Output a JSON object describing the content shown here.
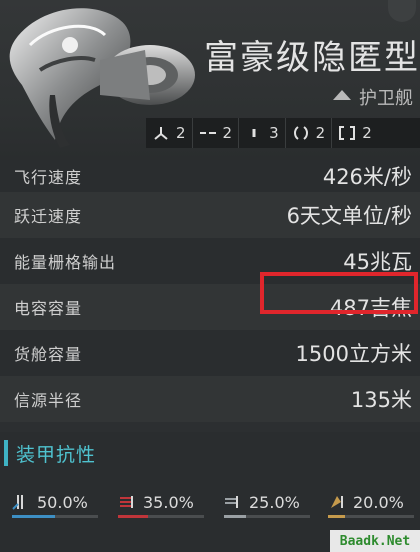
{
  "ship": {
    "name": "富豪级隐匿型",
    "class": "护卫舰"
  },
  "slots": [
    {
      "icon": "high-slot-icon",
      "count": "2"
    },
    {
      "icon": "mid-slot-icon",
      "count": "2"
    },
    {
      "icon": "low-slot-icon",
      "count": "3"
    },
    {
      "icon": "rig-slot-icon",
      "count": "2"
    },
    {
      "icon": "subsystem-slot-icon",
      "count": "2"
    }
  ],
  "stats": [
    {
      "label": "飞行速度",
      "value": "426米/秒"
    },
    {
      "label": "跃迁速度",
      "value": "6天文单位/秒"
    },
    {
      "label": "能量栅格输出",
      "value": "45兆瓦"
    },
    {
      "label": "电容容量",
      "value": "487吉焦"
    },
    {
      "label": "货舱容量",
      "value": "1500立方米"
    },
    {
      "label": "信源半径",
      "value": "135米"
    }
  ],
  "armor": {
    "title": "装甲抗性",
    "resists": [
      {
        "icon": "em-resist-icon",
        "value": "50.0%",
        "fraction": 0.5,
        "color": "#3d8fc4"
      },
      {
        "icon": "thermal-resist-icon",
        "value": "35.0%",
        "fraction": 0.35,
        "color": "#c0353a"
      },
      {
        "icon": "kinetic-resist-icon",
        "value": "25.0%",
        "fraction": 0.25,
        "color": "#9aa0a4"
      },
      {
        "icon": "explosive-resist-icon",
        "value": "20.0%",
        "fraction": 0.2,
        "color": "#c59a4c"
      }
    ]
  },
  "watermark": "Baadk.Net"
}
